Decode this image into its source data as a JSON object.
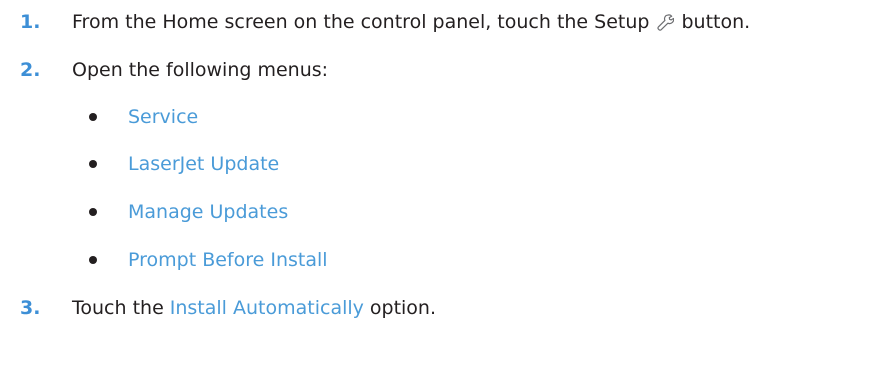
{
  "steps": [
    {
      "number": "1.",
      "text_before": "From the Home screen on the control panel, touch the Setup",
      "icon": "wrench-icon",
      "text_after": "button."
    },
    {
      "number": "2.",
      "text": "Open the following menus:",
      "menus": [
        "Service",
        "LaserJet Update",
        "Manage Updates",
        "Prompt Before Install"
      ]
    },
    {
      "number": "3.",
      "text_before": "Touch the",
      "link": "Install Automatically",
      "text_after": "option."
    }
  ],
  "colors": {
    "step_number": "#3d8fd6",
    "link": "#4a9bd8",
    "text": "#231f20"
  }
}
